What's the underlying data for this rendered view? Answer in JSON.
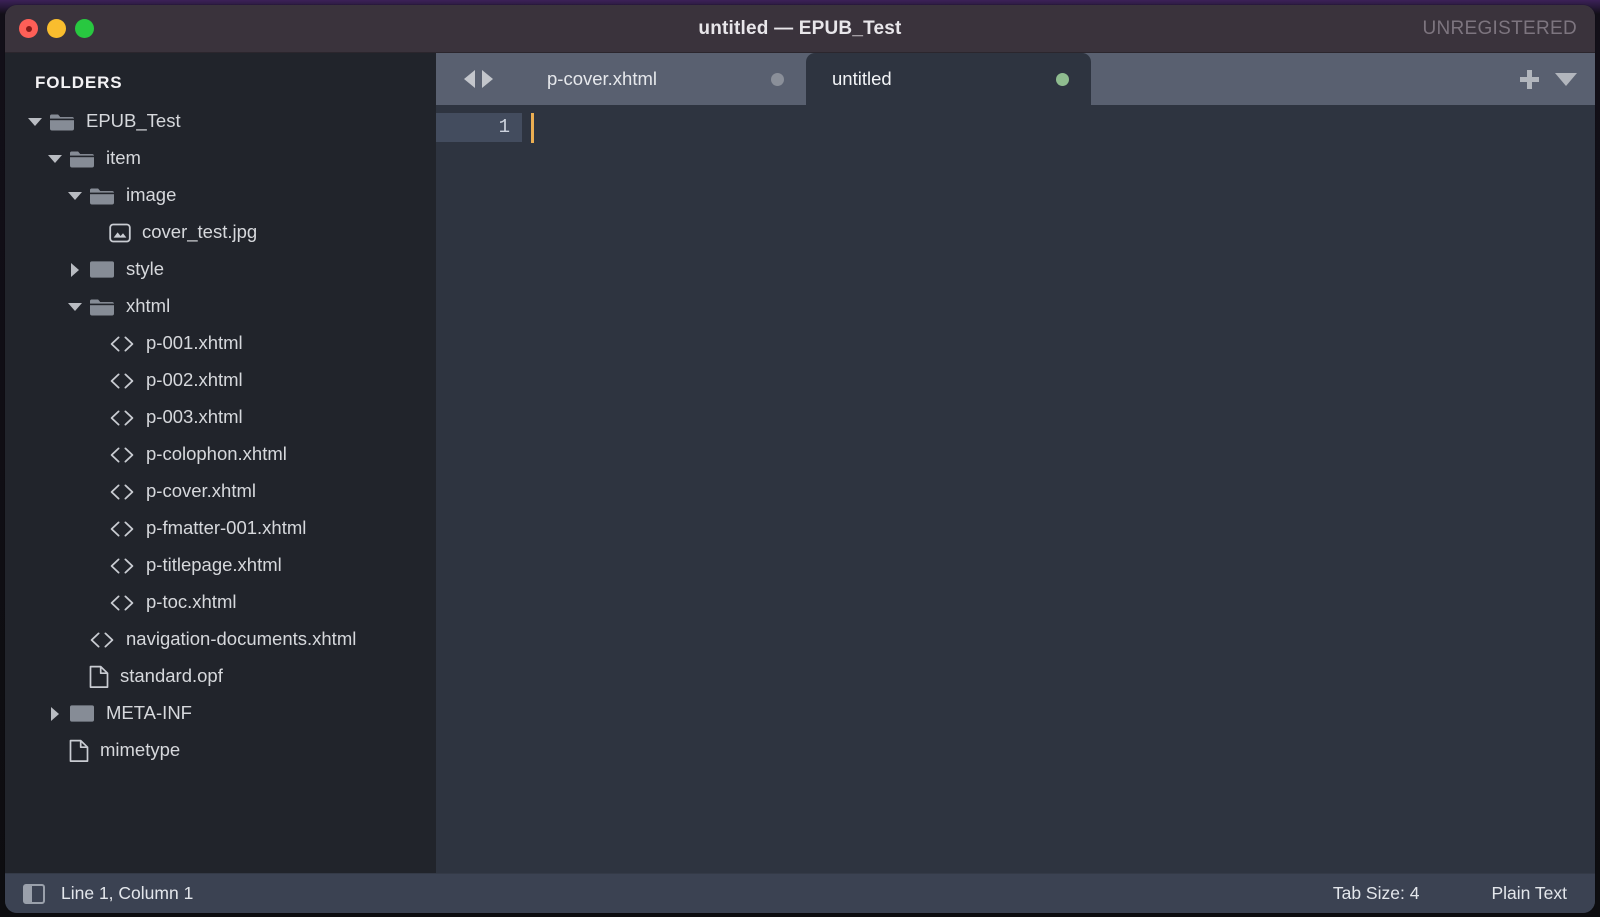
{
  "window": {
    "title": "untitled — EPUB_Test",
    "license_badge": "UNREGISTERED",
    "traffic_lights": [
      {
        "name": "close",
        "color": "#ff5f57"
      },
      {
        "name": "minimize",
        "color": "#f9bd2e"
      },
      {
        "name": "zoom",
        "color": "#28c840"
      }
    ]
  },
  "sidebar": {
    "header": "FOLDERS",
    "tree": [
      {
        "label": "EPUB_Test",
        "icon": "folder-open-icon",
        "arrow": "down",
        "depth": 0
      },
      {
        "label": "item",
        "icon": "folder-open-icon",
        "arrow": "down",
        "depth": 1
      },
      {
        "label": "image",
        "icon": "folder-open-icon",
        "arrow": "down",
        "depth": 2
      },
      {
        "label": "cover_test.jpg",
        "icon": "image-file-icon",
        "arrow": "none",
        "depth": 3
      },
      {
        "label": "style",
        "icon": "folder-closed-icon",
        "arrow": "right",
        "depth": 2
      },
      {
        "label": "xhtml",
        "icon": "folder-open-icon",
        "arrow": "down",
        "depth": 2
      },
      {
        "label": "p-001.xhtml",
        "icon": "code-file-icon",
        "arrow": "none",
        "depth": 3
      },
      {
        "label": "p-002.xhtml",
        "icon": "code-file-icon",
        "arrow": "none",
        "depth": 3
      },
      {
        "label": "p-003.xhtml",
        "icon": "code-file-icon",
        "arrow": "none",
        "depth": 3
      },
      {
        "label": "p-colophon.xhtml",
        "icon": "code-file-icon",
        "arrow": "none",
        "depth": 3
      },
      {
        "label": "p-cover.xhtml",
        "icon": "code-file-icon",
        "arrow": "none",
        "depth": 3
      },
      {
        "label": "p-fmatter-001.xhtml",
        "icon": "code-file-icon",
        "arrow": "none",
        "depth": 3
      },
      {
        "label": "p-titlepage.xhtml",
        "icon": "code-file-icon",
        "arrow": "none",
        "depth": 3
      },
      {
        "label": "p-toc.xhtml",
        "icon": "code-file-icon",
        "arrow": "none",
        "depth": 3
      },
      {
        "label": "navigation-documents.xhtml",
        "icon": "code-file-icon",
        "arrow": "none",
        "depth": 2
      },
      {
        "label": "standard.opf",
        "icon": "plain-file-icon",
        "arrow": "none",
        "depth": 2
      },
      {
        "label": "META-INF",
        "icon": "folder-closed-icon",
        "arrow": "right",
        "depth": 1
      },
      {
        "label": "mimetype",
        "icon": "plain-file-icon",
        "arrow": "none",
        "depth": 1
      }
    ]
  },
  "tabbar": {
    "nav_back_icon": "arrow-left-icon",
    "nav_forward_icon": "arrow-right-icon",
    "tabs": [
      {
        "label": "p-cover.xhtml",
        "active": false,
        "dot_color": "#8a8f99"
      },
      {
        "label": "untitled",
        "active": true,
        "dot_color": "#8fbc8f"
      }
    ],
    "new_tab_icon": "plus-icon",
    "tab_menu_icon": "chevron-down-icon"
  },
  "editor": {
    "line_number": "1",
    "content": "",
    "caret_color": "#ebae52"
  },
  "statusbar": {
    "sidebar_toggle_icon": "sidebar-toggle-icon",
    "line_column": "Line 1, Column 1",
    "tab_size": "Tab Size: 4",
    "syntax": "Plain Text"
  }
}
